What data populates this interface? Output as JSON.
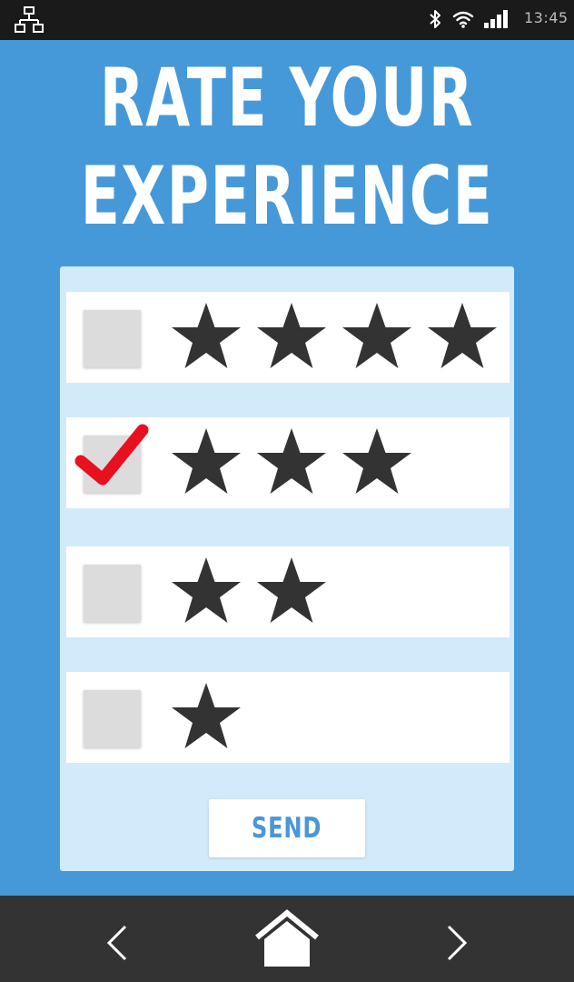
{
  "status_bar": {
    "time": "13:45",
    "icons": [
      "network-icon",
      "bluetooth-icon",
      "wifi-icon",
      "signal-icon"
    ],
    "background": "#1a1a1a"
  },
  "title": {
    "line1": "RATE YOUR",
    "line2": "EXPERIENCE"
  },
  "rating_options": [
    {
      "stars": 4,
      "checked": false
    },
    {
      "stars": 3,
      "checked": true
    },
    {
      "stars": 2,
      "checked": false
    },
    {
      "stars": 1,
      "checked": false
    }
  ],
  "send_label": "SEND",
  "nav_bar": {
    "icons": [
      "back-arrow-icon",
      "home-icon",
      "forward-arrow-icon"
    ],
    "background": "#333333"
  },
  "colors": {
    "background": "#4699d9",
    "card": "#d2ebfb",
    "star": "#333333",
    "checkmark": "#e8101e",
    "send_text": "#4a97d6"
  }
}
